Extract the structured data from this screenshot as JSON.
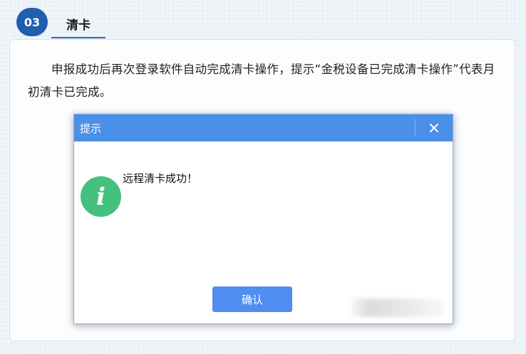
{
  "section": {
    "number": "03",
    "title": "清卡"
  },
  "description": "申报成功后再次登录软件自动完成清卡操作，提示“金税设备已完成清卡操作”代表月初清卡已完成。",
  "dialog": {
    "title": "提示",
    "close_icon": "close-icon",
    "info_icon": "info-icon",
    "info_glyph": "i",
    "message": "远程清卡成功！",
    "confirm_label": "确认"
  },
  "colors": {
    "badge": "#1f5fae",
    "titlebar": "#4a90e8",
    "info_icon": "#45c07f",
    "button": "#4f8ef0"
  }
}
